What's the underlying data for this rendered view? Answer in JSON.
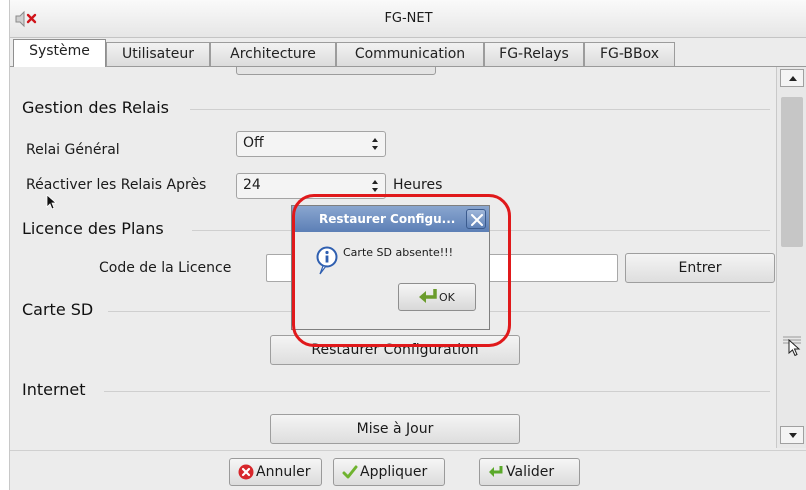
{
  "window": {
    "title": "FG-NET"
  },
  "tabs": [
    {
      "label": "Système",
      "active": true
    },
    {
      "label": "Utilisateur"
    },
    {
      "label": "Architecture"
    },
    {
      "label": "Communication"
    },
    {
      "label": "FG-Relays"
    },
    {
      "label": "FG-BBox"
    }
  ],
  "relais": {
    "section_title": "Gestion des Relais",
    "general_label": "Relai Général",
    "general_value": "Off",
    "reactivate_label": "Réactiver les Relais Après",
    "reactivate_value": "24",
    "reactivate_unit": "Heures"
  },
  "licence": {
    "section_title": "Licence des Plans",
    "code_label": "Code de la Licence",
    "code_value": "",
    "enter_button": "Entrer"
  },
  "carte_sd": {
    "section_title": "Carte SD",
    "restore_button": "Restaurer Configuration"
  },
  "internet": {
    "section_title": "Internet",
    "update_button": "Mise à Jour"
  },
  "footer": {
    "cancel": "Annuler",
    "apply": "Appliquer",
    "validate": "Valider"
  },
  "dialog": {
    "title": "Restaurer Configu...",
    "message": "Carte SD absente!!!",
    "ok": "OK"
  },
  "colors": {
    "highlight": "#e0191b",
    "dialog_title": "#5c7fb6"
  }
}
